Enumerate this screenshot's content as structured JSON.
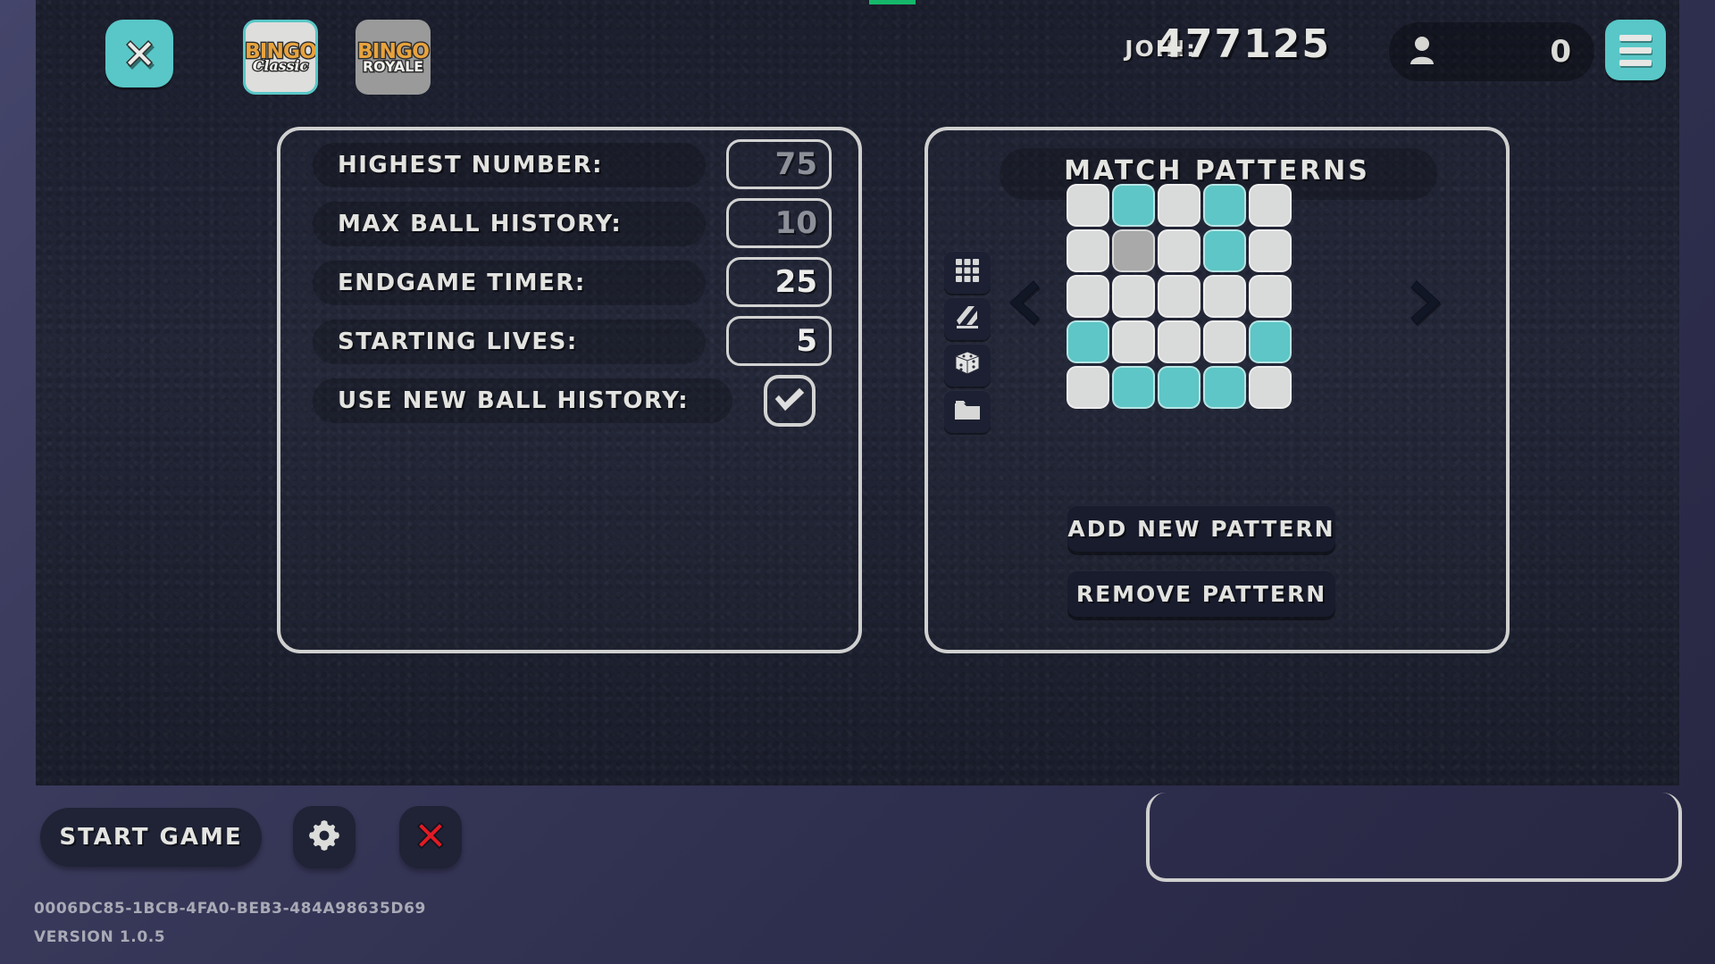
{
  "colors": {
    "accent_teal": "#59c7c7",
    "cell_on": "#5ec6c6",
    "cell_off": "#d9dada",
    "cell_hover": "#a8a9a8",
    "panel_border": "#cfd0cf",
    "viewport_bg": "#1d2030",
    "desktop_bg": "#3a3a5c",
    "danger_red": "#e01b24",
    "logo_orange": "#e8a33d",
    "status_green": "#15b86a"
  },
  "topbar": {
    "close_icon": "close-x-icon",
    "modes": [
      {
        "name": "classic",
        "line1": "BINGO",
        "line2": "Classic",
        "selected": true
      },
      {
        "name": "royale",
        "line1": "BINGO",
        "line2": "ROYALE",
        "selected": false
      }
    ],
    "join_label": "JOIN:",
    "join_code": "477125",
    "player_icon": "person-icon",
    "player_count": "0",
    "menu_icon": "hamburger-menu-icon"
  },
  "settings_panel": {
    "rows": [
      {
        "label": "HIGHEST NUMBER:",
        "value": "75",
        "type": "number",
        "dim": true
      },
      {
        "label": "MAX BALL HISTORY:",
        "value": "10",
        "type": "number",
        "dim": true
      },
      {
        "label": "ENDGAME TIMER:",
        "value": "25",
        "type": "number",
        "dim": false
      },
      {
        "label": "STARTING LIVES:",
        "value": "5",
        "type": "number",
        "dim": false
      },
      {
        "label": "USE NEW BALL HISTORY:",
        "value": "",
        "type": "checkbox",
        "checked": true
      }
    ]
  },
  "patterns_panel": {
    "title": "MATCH PATTERNS",
    "tools": [
      {
        "icon": "grid-icon"
      },
      {
        "icon": "diagonal-stripes-icon"
      },
      {
        "icon": "dice-icon"
      },
      {
        "icon": "folder-icon"
      }
    ],
    "prev_icon": "chevron-left-icon",
    "next_icon": "chevron-right-icon",
    "grid": [
      [
        "off",
        "on",
        "off",
        "on",
        "off"
      ],
      [
        "off",
        "hover",
        "off",
        "on",
        "off"
      ],
      [
        "off",
        "off",
        "off",
        "off",
        "off"
      ],
      [
        "on",
        "off",
        "off",
        "off",
        "on"
      ],
      [
        "off",
        "on",
        "on",
        "on",
        "off"
      ]
    ],
    "add_label": "ADD NEW PATTERN",
    "remove_label": "REMOVE PATTERN"
  },
  "bottombar": {
    "start_label": "START GAME",
    "settings_icon": "gear-icon",
    "quit_icon": "close-x-red-icon"
  },
  "footer": {
    "session_id": "0006DC85-1BCB-4FA0-BEB3-484A98635D69",
    "version": "VERSION 1.0.5"
  }
}
